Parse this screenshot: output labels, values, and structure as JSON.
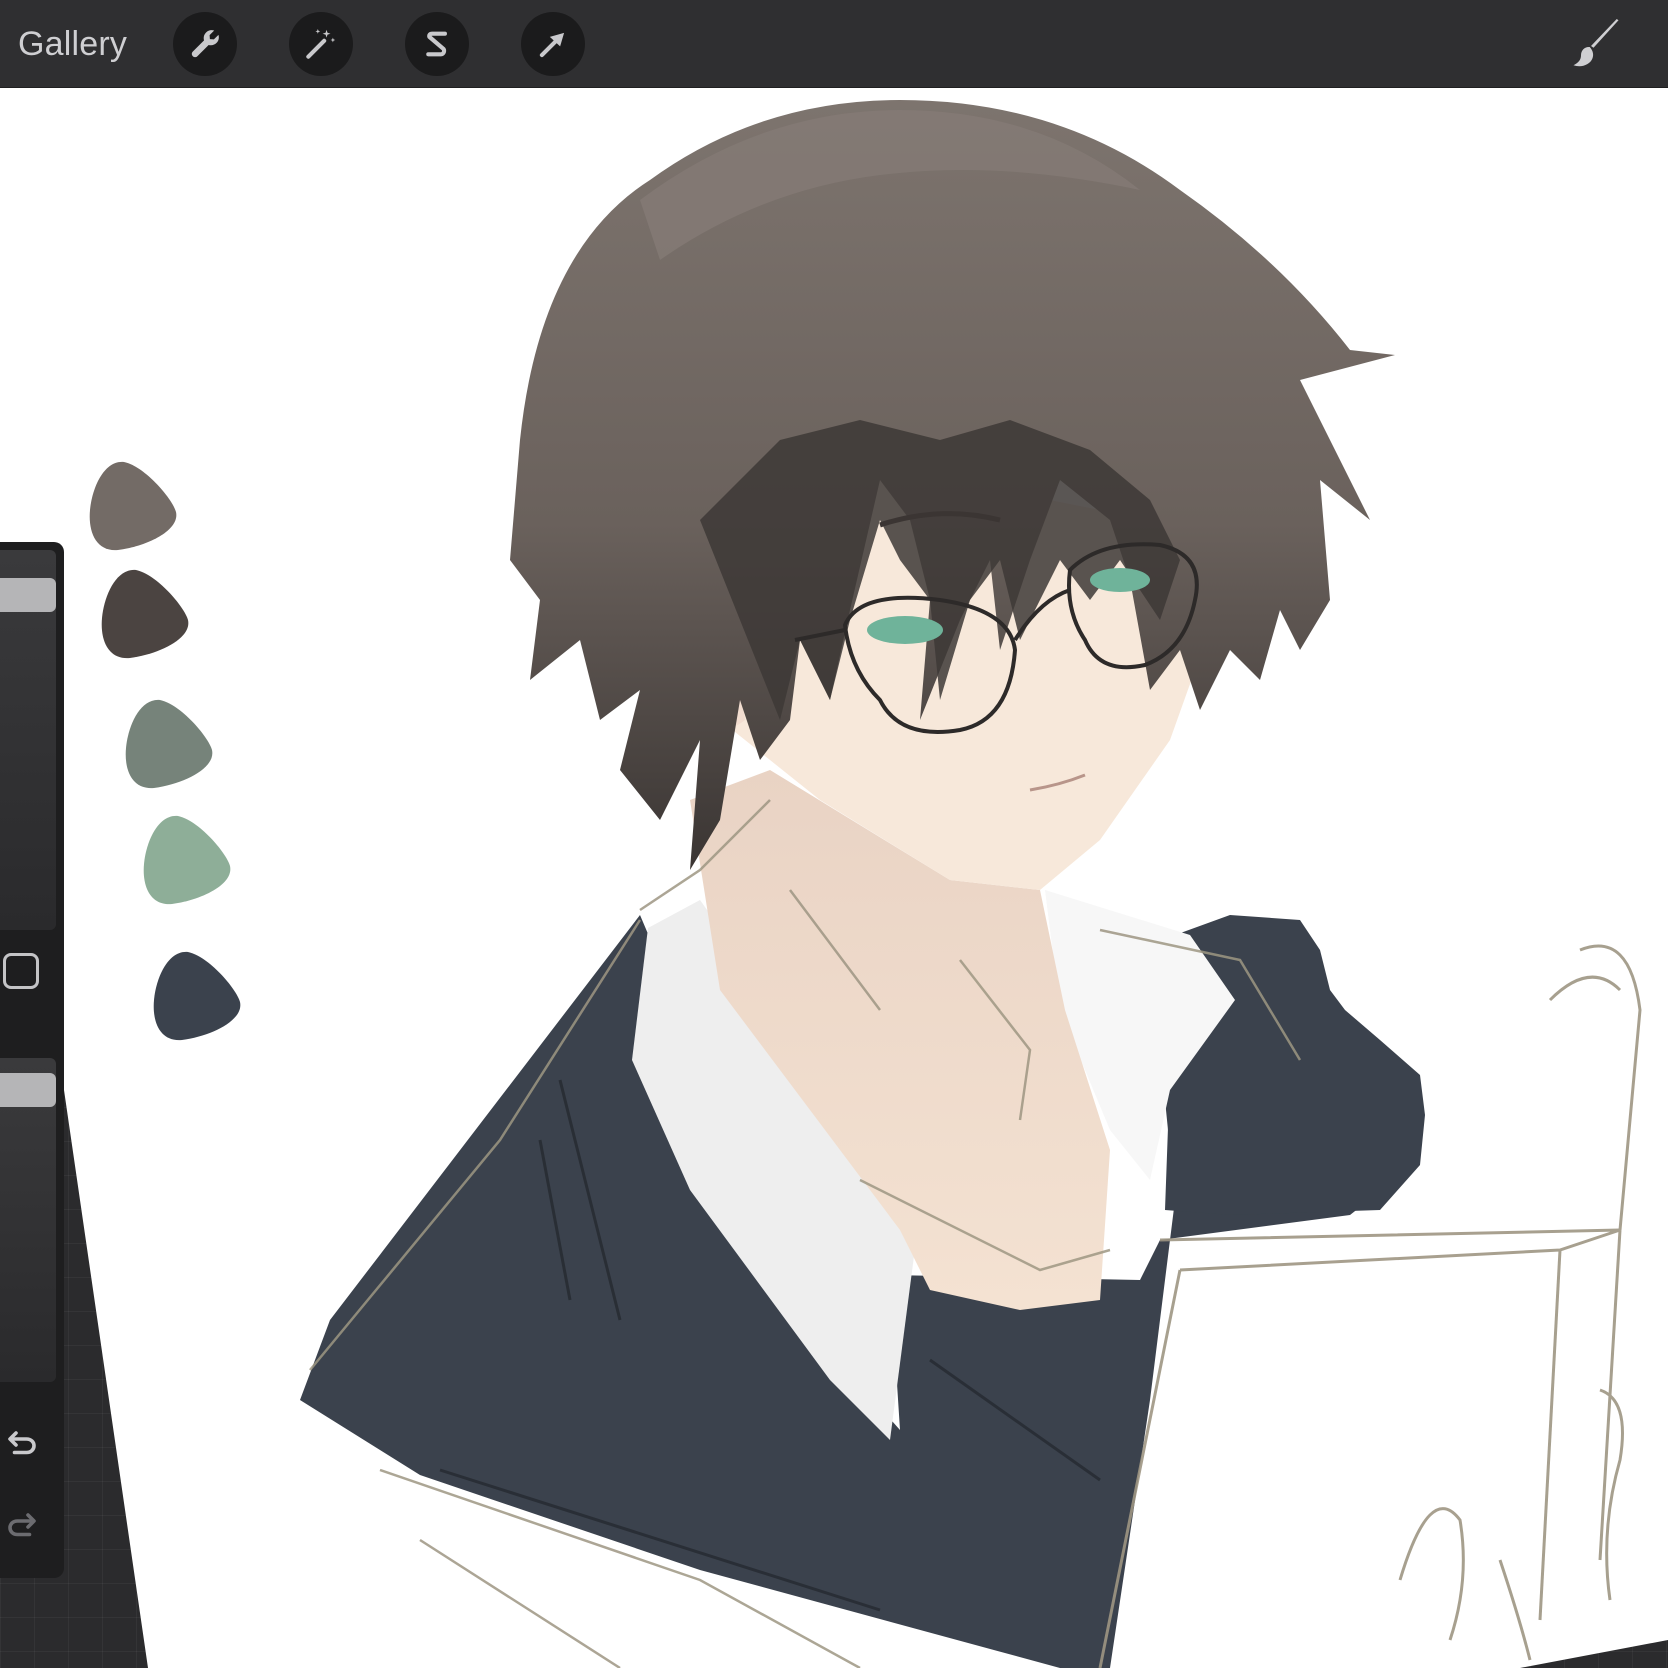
{
  "toolbar": {
    "gallery_label": "Gallery",
    "tools": [
      {
        "name": "actions",
        "icon": "wrench-icon"
      },
      {
        "name": "adjustments",
        "icon": "magic-wand-icon"
      },
      {
        "name": "selection",
        "icon": "selection-s-icon"
      },
      {
        "name": "transform",
        "icon": "arrow-cursor-icon"
      }
    ],
    "active_tool_icon": "paintbrush-icon"
  },
  "sidebar": {
    "brush_size_level": 0.92,
    "brush_opacity_level": 0.95,
    "modify_icon": "square-icon",
    "undo_icon": "undo-icon",
    "redo_icon": "redo-icon"
  },
  "palette": {
    "swatches": [
      "#736b66",
      "#4b4441",
      "#76837a",
      "#8eae98",
      "#3b424d"
    ]
  },
  "artwork": {
    "colors": {
      "hair": "#7a706a",
      "hair_dark": "#3f3a38",
      "skin": "#f6e6d8",
      "skin_shadow": "#e8cfc2",
      "jacket": "#3b424d",
      "shirt": "#eeeeee",
      "eyes": "#6fb39a",
      "sketch": "#9e9683"
    }
  }
}
